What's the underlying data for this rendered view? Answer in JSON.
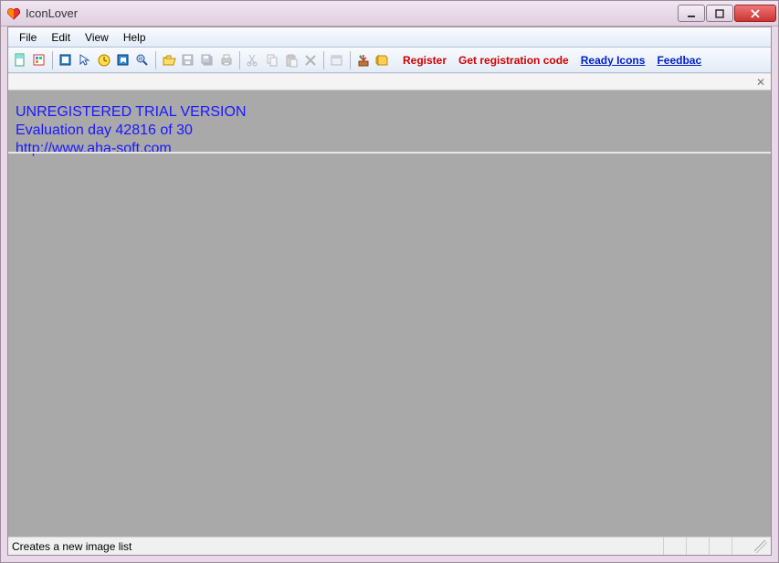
{
  "window": {
    "title": "IconLover"
  },
  "menu": {
    "file": "File",
    "edit": "Edit",
    "view": "View",
    "help": "Help"
  },
  "toolbar_links": {
    "register": "Register",
    "get_code": "Get registration code",
    "ready_icons": "Ready Icons",
    "feedback": "Feedbac"
  },
  "trial": {
    "line1": "UNREGISTERED TRIAL VERSION",
    "line2": "Evaluation day 42816 of 30",
    "line3": "http://www.aha-soft.com"
  },
  "status": {
    "text": "Creates a new image list"
  }
}
